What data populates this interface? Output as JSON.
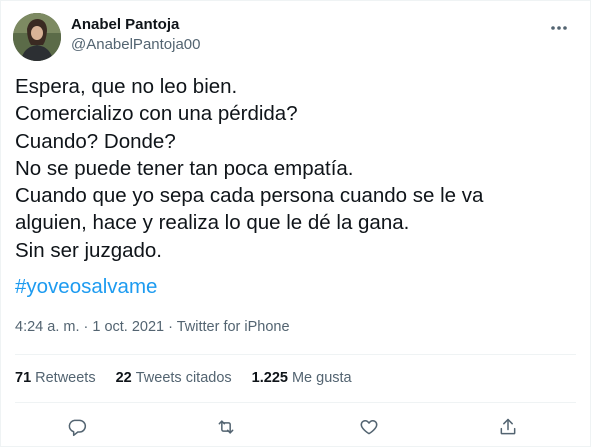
{
  "author": {
    "display_name": "Anabel Pantoja",
    "handle": "@AnabelPantoja00"
  },
  "tweet": {
    "text": "Espera, que no leo bien.\nComercializo con una pérdida?\nCuando? Donde?\nNo se puede tener tan poca empatía.\nCuando que yo sepa cada persona cuando se le va\nalguien, hace y realiza lo que le dé la gana.\nSin ser juzgado.",
    "hashtag": "#yoveosalvame",
    "meta": "4:24 a. m. · 1 oct. 2021 · Twitter for iPhone"
  },
  "stats": [
    {
      "number": "71",
      "label": "Retweets"
    },
    {
      "number": "22",
      "label": "Tweets citados"
    },
    {
      "number": "1.225",
      "label": "Me gusta"
    }
  ],
  "actions": [
    {
      "icon": "reply-icon"
    },
    {
      "icon": "retweet-icon"
    },
    {
      "icon": "like-icon"
    },
    {
      "icon": "share-icon"
    }
  ],
  "colors": {
    "text": "#0f1419",
    "secondary": "#536471",
    "link": "#1d9bf0",
    "divider": "#eff3f4"
  }
}
